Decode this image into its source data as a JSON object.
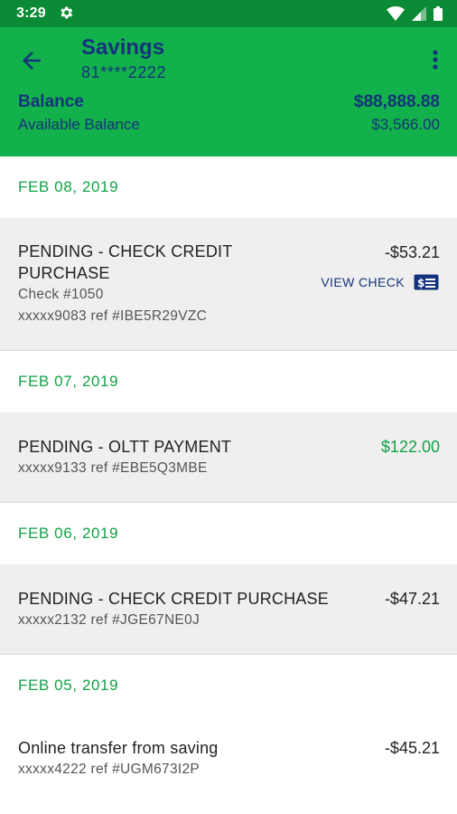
{
  "status_bar": {
    "time": "3:29",
    "icons": [
      "gear-icon",
      "wifi-icon",
      "signal-icon",
      "battery-icon"
    ]
  },
  "header": {
    "account_name": "Savings",
    "account_number": "81****2222",
    "balance_label": "Balance",
    "balance_value": "$88,888.88",
    "available_label": "Available Balance",
    "available_value": "$3,566.00",
    "back_icon": "arrow-left-icon",
    "menu_icon": "more-vert-icon"
  },
  "colors": {
    "status_bar": "#0a8a34",
    "header": "#12b14b",
    "navy": "#15337a",
    "date_green": "#12a145",
    "row_gray": "#efefef"
  },
  "groups": [
    {
      "date": "FEB 08, 2019",
      "transactions": [
        {
          "desc_line1": "PENDING - CHECK CREDIT",
          "desc_line2": "PURCHASE",
          "check": "Check #1050",
          "ref": "xxxxx9083 ref #IBE5R29VZC",
          "amount": "-$53.21",
          "view_check": "VIEW CHECK"
        }
      ]
    },
    {
      "date": "FEB 07, 2019",
      "transactions": [
        {
          "desc": "PENDING - OLTT PAYMENT",
          "ref": "xxxxx9133 ref #EBE5Q3MBE",
          "amount": "$122.00"
        }
      ]
    },
    {
      "date": "FEB 06, 2019",
      "transactions": [
        {
          "desc": "PENDING - CHECK CREDIT PURCHASE",
          "ref": "xxxxx2132 ref #JGE67NE0J",
          "amount": "-$47.21"
        }
      ]
    },
    {
      "date": "FEB 05, 2019",
      "transactions": [
        {
          "desc": "Online transfer from saving",
          "ref": "xxxxx4222 ref #UGM673I2P",
          "amount": "-$45.21"
        }
      ]
    }
  ]
}
